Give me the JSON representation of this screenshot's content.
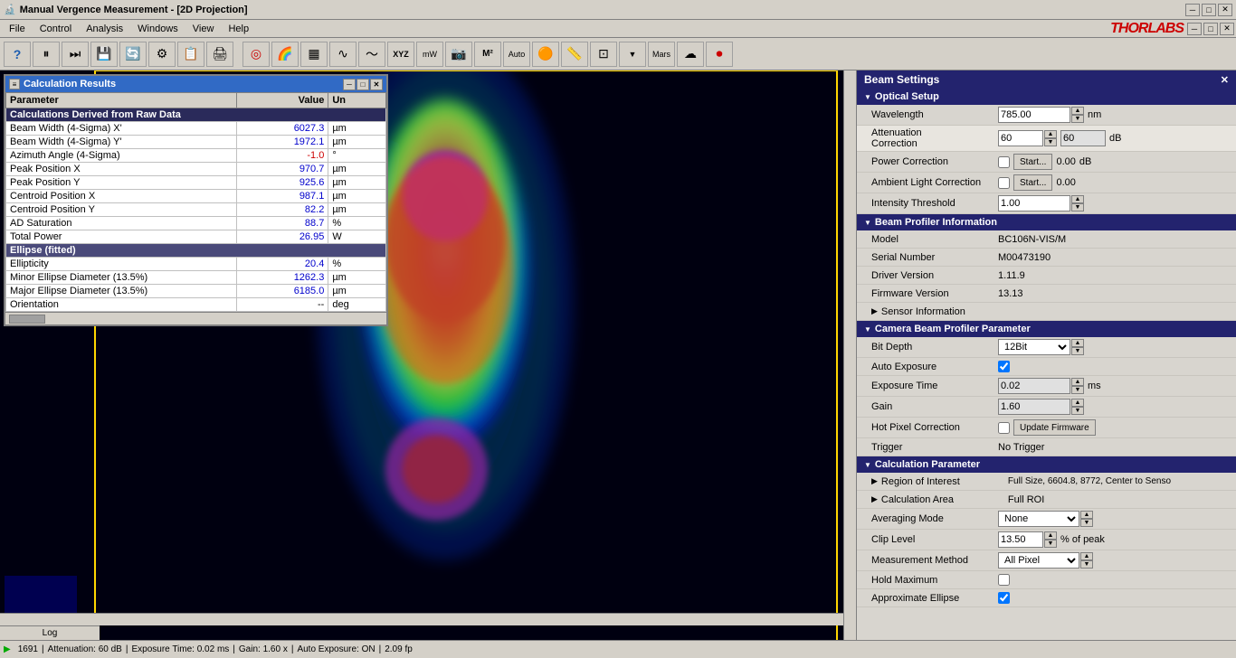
{
  "titleBar": {
    "title": "Manual Vergence Measurement - [2D Projection]",
    "minBtn": "─",
    "maxBtn": "□",
    "closeBtn": "✕"
  },
  "menuBar": {
    "items": [
      "File",
      "Control",
      "Analysis",
      "Windows",
      "View",
      "Help"
    ]
  },
  "calcResults": {
    "title": "Calculation Results",
    "columns": [
      "Parameter",
      "Value",
      "Un"
    ],
    "sectionRaw": "Calculations Derived from Raw Data",
    "rows": [
      {
        "param": "Beam Width (4-Sigma) X'",
        "value": "6027.3",
        "unit": "µm",
        "valueClass": "value-blue"
      },
      {
        "param": "Beam Width (4-Sigma) Y'",
        "value": "1972.1",
        "unit": "µm",
        "valueClass": "value-blue"
      },
      {
        "param": "Azimuth Angle (4-Sigma)",
        "value": "-1.0",
        "unit": "°",
        "valueClass": "value-red"
      },
      {
        "param": "Peak Position X",
        "value": "970.7",
        "unit": "µm",
        "valueClass": "value-blue"
      },
      {
        "param": "Peak Position Y",
        "value": "925.6",
        "unit": "µm",
        "valueClass": "value-blue"
      },
      {
        "param": "Centroid Position X",
        "value": "987.1",
        "unit": "µm",
        "valueClass": "value-blue"
      },
      {
        "param": "Centroid Position Y",
        "value": "82.2",
        "unit": "µm",
        "valueClass": "value-blue"
      },
      {
        "param": "AD Saturation",
        "value": "88.7",
        "unit": "%",
        "valueClass": "value-blue"
      },
      {
        "param": "Total Power",
        "value": "26.95",
        "unit": "W",
        "valueClass": "value-blue"
      }
    ],
    "sectionEllipse": "Ellipse (fitted)",
    "ellipseRows": [
      {
        "param": "Ellipticity",
        "value": "20.4",
        "unit": "%",
        "valueClass": "value-blue"
      },
      {
        "param": "Minor Ellipse Diameter (13.5%)",
        "value": "1262.3",
        "unit": "µm",
        "valueClass": "value-blue"
      },
      {
        "param": "Major Ellipse Diameter (13.5%)",
        "value": "6185.0",
        "unit": "µm",
        "valueClass": "value-blue"
      },
      {
        "param": "Orientation",
        "value": "--",
        "unit": "deg",
        "valueClass": ""
      }
    ]
  },
  "rightPanel": {
    "title": "Beam Settings",
    "opticalSetup": {
      "label": "Optical Setup",
      "wavelength": {
        "label": "Wavelength",
        "value": "785.00",
        "unit": "nm"
      },
      "attenuation": {
        "label": "Attenuation",
        "value1": "60",
        "value2": "60",
        "unit": "dB"
      },
      "powerCorrection": {
        "label": "Power Correction",
        "startBtn": "Start...",
        "value": "0.00",
        "unit": "dB"
      },
      "ambientLight": {
        "label": "Ambient Light Correction",
        "startBtn": "Start...",
        "value": "0.00"
      },
      "intensityThreshold": {
        "label": "Intensity Threshold",
        "value": "1.00"
      }
    },
    "beamProfilerInfo": {
      "label": "Beam Profiler Information",
      "model": {
        "label": "Model",
        "value": "BC106N-VIS/M"
      },
      "serialNumber": {
        "label": "Serial Number",
        "value": "M00473190"
      },
      "driverVersion": {
        "label": "Driver Version",
        "value": "1.11.9"
      },
      "firmwareVersion": {
        "label": "Firmware Version",
        "value": "13.13"
      },
      "sensorInfo": {
        "label": "Sensor Information"
      }
    },
    "cameraParams": {
      "label": "Camera Beam Profiler Parameter",
      "bitDepth": {
        "label": "Bit Depth",
        "value": "12Bit"
      },
      "autoExposure": {
        "label": "Auto Exposure",
        "checked": true
      },
      "exposureTime": {
        "label": "Exposure Time",
        "value": "0.02",
        "unit": "ms"
      },
      "gain": {
        "label": "Gain",
        "value": "1.60"
      },
      "hotPixel": {
        "label": "Hot Pixel Correction",
        "btnLabel": "Update Firmware"
      },
      "trigger": {
        "label": "Trigger",
        "value": "No Trigger"
      }
    },
    "calcParams": {
      "label": "Calculation Parameter",
      "roi": {
        "label": "Region of Interest",
        "value": "Full Size, 6604.8, 8772, Center to Senso"
      },
      "calcArea": {
        "label": "Calculation Area",
        "value": "Full ROI"
      },
      "averaging": {
        "label": "Averaging Mode",
        "value": "None"
      },
      "clipLevel": {
        "label": "Clip Level",
        "value": "13.50",
        "unit": "% of peak"
      },
      "measMethod": {
        "label": "Measurement Method",
        "value": "All Pixel"
      },
      "holdMax": {
        "label": "Hold Maximum",
        "checked": false
      },
      "approxEllipse": {
        "label": "Approximate Ellipse",
        "checked": true
      }
    }
  },
  "statusBar": {
    "frame": "1691",
    "attenuation": "Attenuation: 60 dB",
    "exposureTime": "Exposure Time: 0.02 ms",
    "gain": "Gain: 1.60 x",
    "autoExposure": "Auto Exposure: ON",
    "fps": "2.09 fp"
  }
}
